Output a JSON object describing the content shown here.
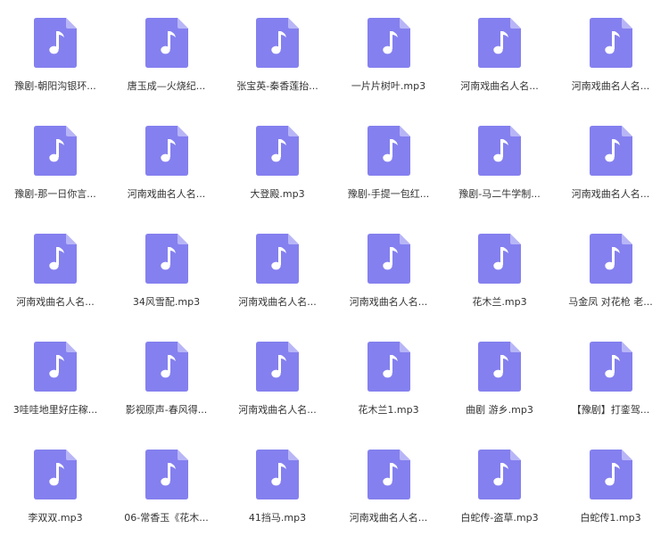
{
  "colors": {
    "icon_fill": "#8480ef",
    "icon_fold": "#b8b5f7",
    "note": "#ffffff",
    "text": "#333333",
    "background": "#ffffff"
  },
  "icon": "music-file-icon",
  "files": [
    "豫剧-朝阳沟银环...",
    "唐玉成—火烧纪...",
    "张宝英-秦香莲抬...",
    "一片片树叶.mp3",
    "河南戏曲名人名...",
    "河南戏曲名人名...",
    "豫剧-那一日你言...",
    "河南戏曲名人名...",
    "大登殿.mp3",
    "豫剧-手提一包红...",
    "豫剧-马二牛学制...",
    "河南戏曲名人名...",
    "河南戏曲名人名...",
    "34风雪配.mp3",
    "河南戏曲名人名...",
    "河南戏曲名人名...",
    "花木兰.mp3",
    "马金凤 对花枪 老...",
    "3哇哇地里好庄稼...",
    "影视原声-春风得...",
    "河南戏曲名人名...",
    "花木兰1.mp3",
    "曲剧 游乡.mp3",
    "【豫剧】打銮驾...",
    "李双双.mp3",
    "06-常香玉《花木...",
    "41挡马.mp3",
    "河南戏曲名人名...",
    "白蛇传-盗草.mp3",
    "白蛇传1.mp3"
  ]
}
